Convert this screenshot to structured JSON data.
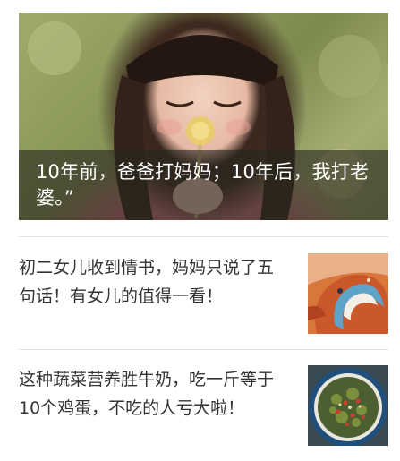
{
  "hero": {
    "title": "10年前，爸爸打妈妈；10年后，我打老婆。”",
    "image": "girl-with-dandelion-photo"
  },
  "items": [
    {
      "title": "初二女儿收到情书，妈妈只说了五句话！有女儿的值得一看！",
      "thumbnail": "orange-painted-wave-illustration"
    },
    {
      "title": "这种蔬菜营养胜牛奶，吃一斤等于10个鸡蛋，不吃的人亏大啦！",
      "thumbnail": "stir-fried-vegetable-dish-photo"
    }
  ]
}
